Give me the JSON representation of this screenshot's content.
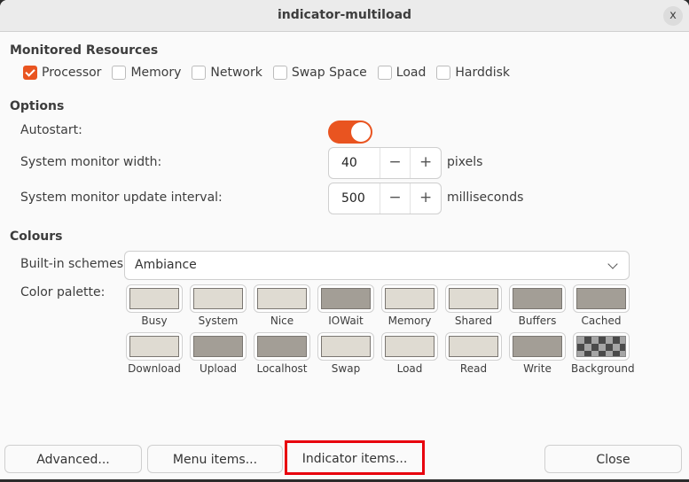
{
  "window": {
    "title": "indicator-multiload",
    "close_label": "x"
  },
  "monitored": {
    "title": "Monitored Resources",
    "items": [
      {
        "label": "Processor",
        "checked": true
      },
      {
        "label": "Memory",
        "checked": false
      },
      {
        "label": "Network",
        "checked": false
      },
      {
        "label": "Swap Space",
        "checked": false
      },
      {
        "label": "Load",
        "checked": false
      },
      {
        "label": "Harddisk",
        "checked": false
      }
    ]
  },
  "options": {
    "title": "Options",
    "autostart": {
      "label": "Autostart:",
      "on": true
    },
    "width": {
      "label": "System monitor width:",
      "value": "40",
      "unit": "pixels",
      "minus": "−",
      "plus": "+"
    },
    "interval": {
      "label": "System monitor update interval:",
      "value": "500",
      "unit": "milliseconds",
      "minus": "−",
      "plus": "+"
    }
  },
  "colours": {
    "title": "Colours",
    "schemes_label": "Built-in schemes:",
    "scheme_value": "Ambiance",
    "palette_label": "Color palette:",
    "palette": [
      {
        "label": "Busy",
        "color": "#dfdbd2"
      },
      {
        "label": "System",
        "color": "#dfdbd2"
      },
      {
        "label": "Nice",
        "color": "#dfdbd2"
      },
      {
        "label": "IOWait",
        "color": "#a39e96"
      },
      {
        "label": "Memory",
        "color": "#dfdbd2"
      },
      {
        "label": "Shared",
        "color": "#dfdbd2"
      },
      {
        "label": "Buffers",
        "color": "#a39e96"
      },
      {
        "label": "Cached",
        "color": "#a39e96"
      },
      {
        "label": "Download",
        "color": "#dfdbd2"
      },
      {
        "label": "Upload",
        "color": "#a39e96"
      },
      {
        "label": "Localhost",
        "color": "#a39e96"
      },
      {
        "label": "Swap",
        "color": "#dfdbd2"
      },
      {
        "label": "Load",
        "color": "#dfdbd2"
      },
      {
        "label": "Read",
        "color": "#dfdbd2"
      },
      {
        "label": "Write",
        "color": "#a39e96"
      },
      {
        "label": "Background",
        "color": "checkerboard"
      }
    ]
  },
  "buttons": {
    "advanced": "Advanced...",
    "menu_items": "Menu items...",
    "indicator_items": "Indicator items...",
    "close": "Close"
  },
  "accent_color": "#e95420",
  "highlight_color": "#e8000d"
}
